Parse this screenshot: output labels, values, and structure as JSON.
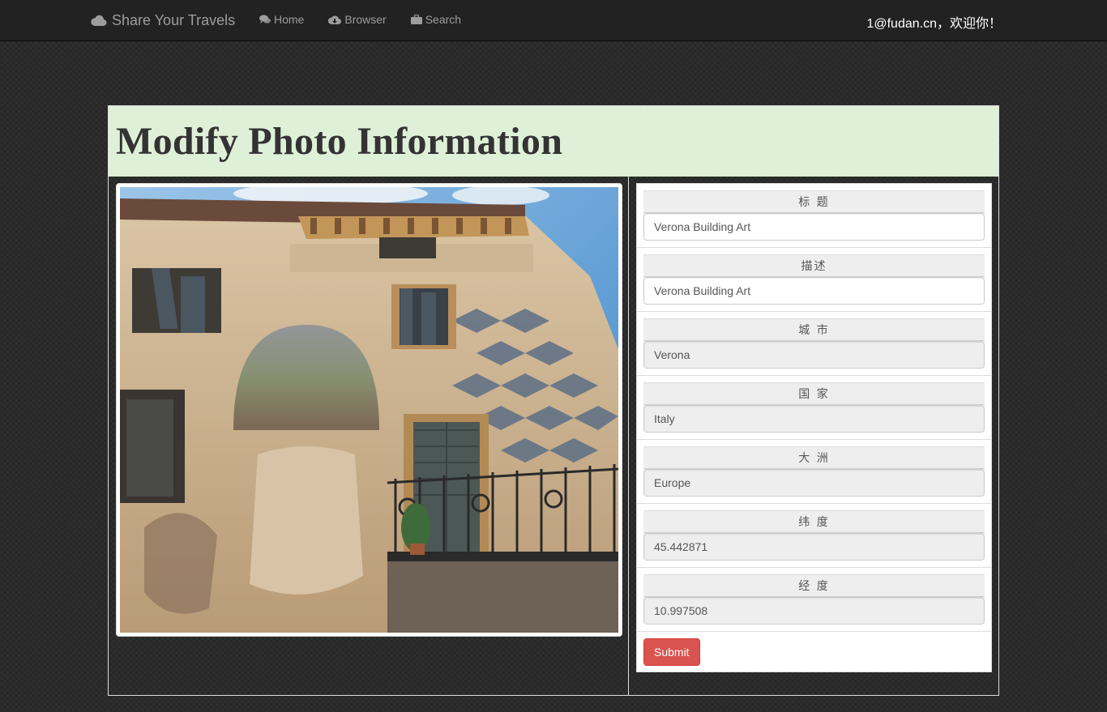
{
  "navbar": {
    "brand": "Share Your Travels",
    "links": [
      {
        "label": "Home",
        "icon": "comments-icon"
      },
      {
        "label": "Browser",
        "icon": "cloud-download-icon"
      },
      {
        "label": "Search",
        "icon": "briefcase-icon"
      }
    ],
    "welcome": "1@fudan.cn，欢迎你！"
  },
  "page": {
    "title": "Modify Photo Information"
  },
  "photo": {
    "alt": "Verona Building Art"
  },
  "form": {
    "fields": [
      {
        "label": "标 题",
        "value": "Verona Building Art",
        "editable": true
      },
      {
        "label": "描述",
        "value": "Verona Building Art",
        "editable": true
      },
      {
        "label": "城 市",
        "value": "Verona",
        "editable": false
      },
      {
        "label": "国 家",
        "value": "Italy",
        "editable": false
      },
      {
        "label": "大 洲",
        "value": "Europe",
        "editable": false
      },
      {
        "label": "纬 度",
        "value": "45.442871",
        "editable": false
      },
      {
        "label": "经 度",
        "value": "10.997508",
        "editable": false
      }
    ],
    "submit_label": "Submit"
  },
  "colors": {
    "navbar_bg": "#222222",
    "heading_bg": "#dff0d8",
    "submit_bg": "#d9534f",
    "sky": "#5b9bd5",
    "facade": "#e6d5bd",
    "stone_trim": "#b08a55"
  }
}
